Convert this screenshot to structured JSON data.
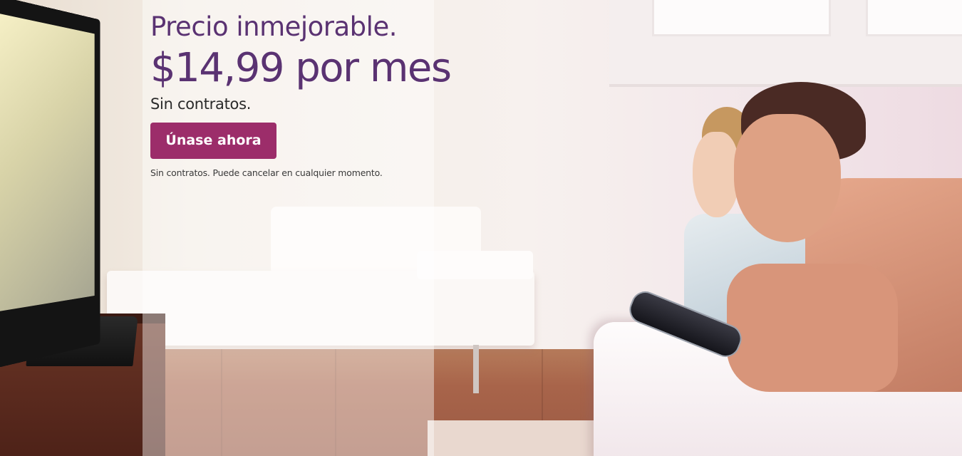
{
  "hero": {
    "headline": "Precio inmejorable.",
    "price": "$14,99 por mes",
    "subtitle": "Sin contratos.",
    "cta_label": "Únase ahora",
    "disclaimer": "Sin contratos. Puede cancelar en cualquier momento.",
    "colors": {
      "headline": "#5a3272",
      "cta_background": "#9c2d6a",
      "cta_text": "#ffffff"
    }
  }
}
